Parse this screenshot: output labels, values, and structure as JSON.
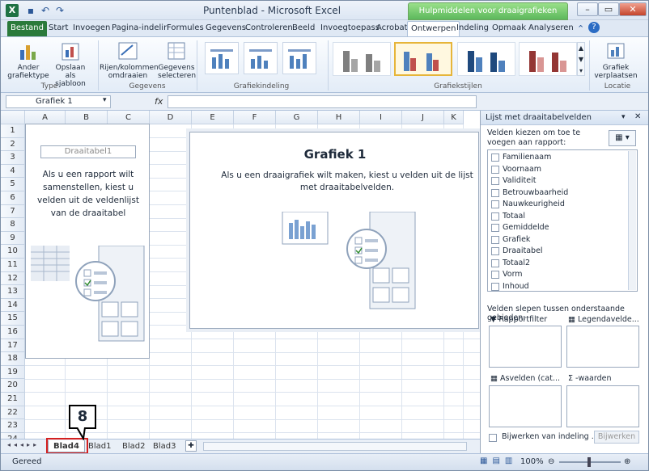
{
  "window": {
    "title": "Puntenblad - Microsoft Excel",
    "context_tool": "Hulpmiddelen voor draaigrafieken"
  },
  "ribbon_tabs": [
    "Bestand",
    "Start",
    "Invoegen",
    "Pagina-indelir",
    "Formules",
    "Gegevens",
    "Controleren",
    "Beeld",
    "Invoegtoepass",
    "Acrobat",
    "Ontwerpen",
    "Indeling",
    "Opmaak",
    "Analyseren"
  ],
  "active_tab": "Ontwerpen",
  "ribbon": {
    "change_type": "Ander grafiektype",
    "save_template": "Opslaan als sjabloon",
    "group_type": "Type",
    "switch_rows": "Rijen/kolommen omdraaien",
    "select_data": "Gegevens selecteren",
    "group_data": "Gegevens",
    "group_layout": "Grafiekindeling",
    "group_styles": "Grafiekstijlen",
    "move_chart": "Grafiek verplaatsen",
    "group_location": "Locatie"
  },
  "namebox": "Grafiek 1",
  "columns": [
    "A",
    "B",
    "C",
    "D",
    "E",
    "F",
    "G",
    "H",
    "I",
    "J",
    "K"
  ],
  "rows": [
    "1",
    "2",
    "3",
    "4",
    "5",
    "6",
    "7",
    "8",
    "9",
    "10",
    "11",
    "12",
    "13",
    "14",
    "15",
    "16",
    "17",
    "18",
    "19",
    "20",
    "21",
    "22",
    "23",
    "24"
  ],
  "pivot_placeholder": {
    "box": "Draaitabel1",
    "text": "Als u een rapport wilt samenstellen, kiest u velden uit de veldenlijst van de draaitabel"
  },
  "chart": {
    "title": "Grafiek 1",
    "text": "Als u een draaigrafiek wilt maken, kiest u velden uit de lijst met draaitabelvelden."
  },
  "sheet_tabs": [
    "Blad4",
    "Blad1",
    "Blad2",
    "Blad3"
  ],
  "callout": "8",
  "field_pane": {
    "title": "Lijst met draaitabelvelden",
    "choose_label": "Velden kiezen om toe te voegen aan rapport:",
    "fields": [
      "Familienaam",
      "Voornaam",
      "Validiteit",
      "Betrouwbaarheid",
      "Nauwkeurigheid",
      "Totaal",
      "Gemiddelde",
      "Grafiek",
      "Draaitabel",
      "Totaal2",
      "Vorm",
      "Inhoud"
    ],
    "drag_label": "Velden slepen tussen onderstaande gebieden:",
    "areas": {
      "filter": "Rapportfilter",
      "legend": "Legendavelde...",
      "axis": "Asvelden (cat...",
      "values": "-waarden"
    },
    "defer_label": "Bijwerken van indeling ...",
    "update_button": "Bijwerken"
  },
  "status": {
    "left": "Gereed",
    "zoom": "100%"
  }
}
